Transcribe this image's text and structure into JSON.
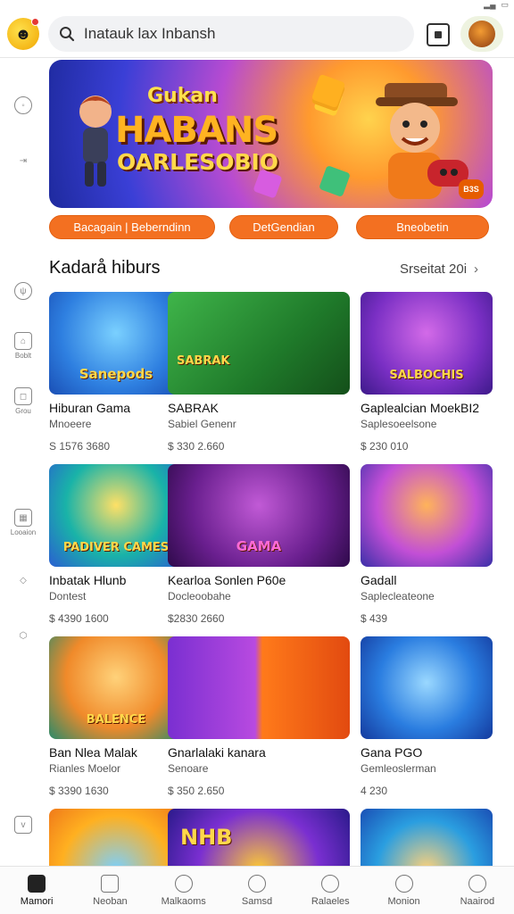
{
  "search": {
    "value": "Inatauk lax Inbansh"
  },
  "hero": {
    "line1": "Gukan",
    "line2": "HABANS",
    "line3": "OARLESOBIO",
    "badge": "B3S"
  },
  "pills": [
    "Bacagain | Beberndinn",
    "DetGendian",
    "Bneobetin"
  ],
  "rail": [
    "",
    "",
    "",
    "Boblt",
    "Grou",
    "Looaion",
    "",
    "",
    ""
  ],
  "section": {
    "title": "Kadarå hiburs",
    "link": "Srseitat 20i"
  },
  "cards": [
    {
      "name": "Hiburan Gama",
      "sub": "Mnoeere",
      "meta": "S 1576 3680",
      "thumb_text": "Sanepods"
    },
    {
      "name": "SABRAK",
      "sub": "Sabiel Genenr",
      "meta": "$ 330 2.660",
      "thumb_text": "SABRAK"
    },
    {
      "name": "Gaplealcian MoekBI2",
      "sub": "Saplesoeelsone",
      "meta": "$ 230 010",
      "thumb_text": "SALBOCHIS"
    },
    {
      "name": "Inbatak Hlunb",
      "sub": "Dontest",
      "meta": "$ 4390 1600",
      "thumb_text": "PADIVER CAMES"
    },
    {
      "name": "Kearloa Sonlen P60e",
      "sub": "Docleoobahe",
      "meta": "$2830 2660",
      "thumb_text": "GAMA"
    },
    {
      "name": "Gadall",
      "sub": "Saplecleateone",
      "meta": "$ 439",
      "thumb_text": ""
    },
    {
      "name": "Ban Nlea Malak",
      "sub": "Rianles Moelor",
      "meta": "$ 3390 1630",
      "thumb_text": "BALENCE"
    },
    {
      "name": "Gnarlalaki kanara",
      "sub": "Senoare",
      "meta": "$ 350 2.650",
      "thumb_text": ""
    },
    {
      "name": "Gana PGO",
      "sub": "Gemleoslerman",
      "meta": "4 230",
      "thumb_text": ""
    },
    {
      "name": "",
      "sub": "",
      "meta": "",
      "thumb_text": ""
    },
    {
      "name": "",
      "sub": "",
      "meta": "",
      "thumb_text": "NHB"
    },
    {
      "name": "",
      "sub": "",
      "meta": "",
      "thumb_text": ""
    }
  ],
  "bottom_nav": [
    "Mamori",
    "Neoban",
    "Malkaoms",
    "Samsd",
    "Ralaeles",
    "Monion",
    "Naairod"
  ],
  "colors": {
    "accent": "#f37021",
    "text": "#111111",
    "muted": "#555555"
  },
  "icons": {
    "logo": "game-logo-icon",
    "search": "search-icon",
    "square": "square-button-icon",
    "avatar": "avatar-icon",
    "chevron": "chevron-right-icon"
  }
}
